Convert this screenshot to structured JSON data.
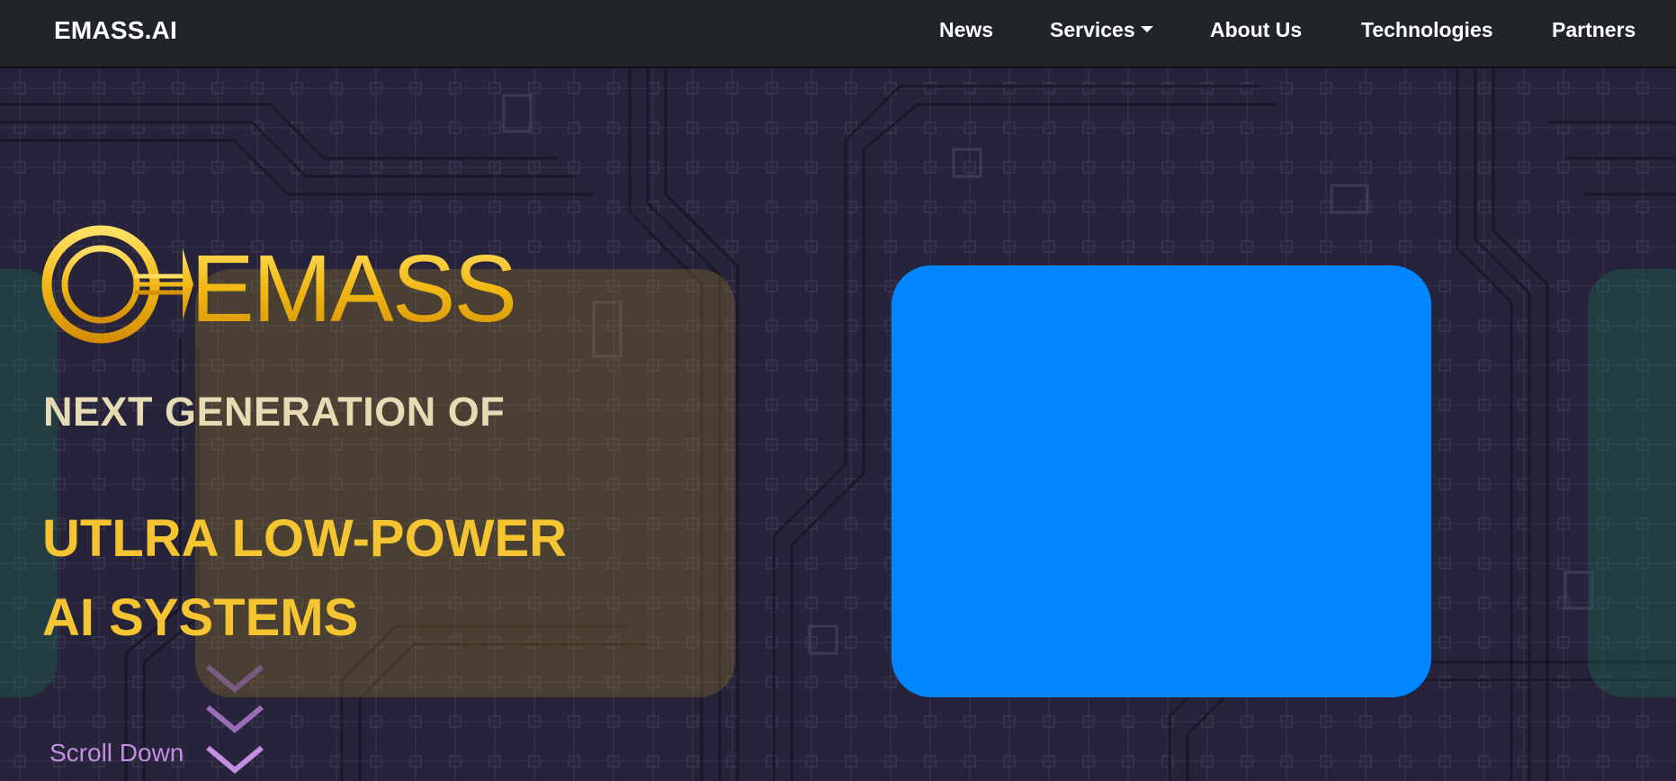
{
  "navbar": {
    "brand": "EMASS.AI",
    "items": [
      {
        "label": "News"
      },
      {
        "label": "Services"
      },
      {
        "label": "About Us"
      },
      {
        "label": "Technologies"
      },
      {
        "label": "Partners"
      }
    ]
  },
  "hero": {
    "logo_text": "EMASS",
    "headline_line1": "NEXT GENERATION OF",
    "headline_line2": "UTLRA LOW-POWER",
    "headline_line3": "AI SYSTEMS",
    "scroll_label": "Scroll Down"
  },
  "colors": {
    "navbar_bg": "#212529",
    "headline_primary": "#e6dbb4",
    "headline_accent": "#f5c531",
    "scroll_accent": "#c48ee2",
    "media_box": "#0086ff"
  },
  "icons": [
    "chevron-down-icon",
    "caret-down-icon"
  ]
}
